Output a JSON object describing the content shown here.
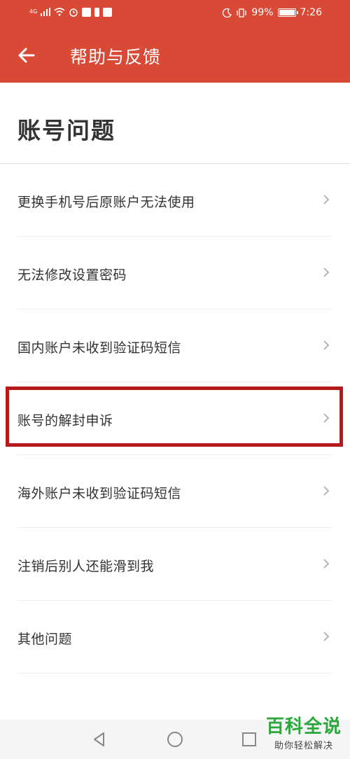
{
  "status_bar": {
    "network": "4G",
    "battery_text": "99%",
    "time": "7:26"
  },
  "header": {
    "title": "帮助与反馈"
  },
  "section": {
    "title": "账号问题"
  },
  "faq_items": [
    {
      "label": "更换手机号后原账户无法使用"
    },
    {
      "label": "无法修改设置密码"
    },
    {
      "label": "国内账户未收到验证码短信"
    },
    {
      "label": "账号的解封申诉"
    },
    {
      "label": "海外账户未收到验证码短信"
    },
    {
      "label": "注销后别人还能滑到我"
    },
    {
      "label": "其他问题"
    }
  ],
  "watermark": {
    "main": "百科全说",
    "sub": "助你轻松解决"
  },
  "colors": {
    "accent": "#d94a36",
    "highlight_border": "#b51b1b",
    "watermark_green": "#2aa83c"
  },
  "icons": {
    "back": "arrow-left-icon",
    "chevron": "chevron-right-icon",
    "nav_back": "triangle-back-icon",
    "nav_home": "circle-home-icon",
    "nav_recent": "square-recent-icon"
  }
}
